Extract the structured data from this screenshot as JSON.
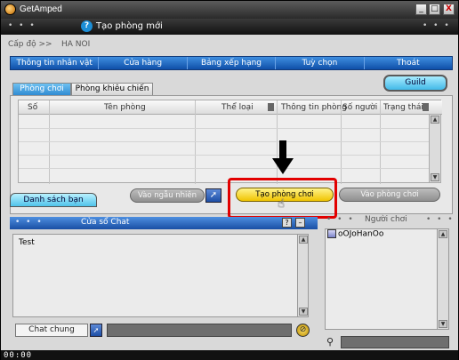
{
  "window": {
    "title": "GetAmped",
    "minimize": "_",
    "maximize": "□",
    "close": "X"
  },
  "subheader": {
    "title": "Tạo phòng mới",
    "help": "?"
  },
  "breadcrumb": {
    "level": "Cấp độ >>",
    "location": "HA NOI"
  },
  "nav": {
    "items": [
      "Thông tin nhân vật",
      "Cửa hàng",
      "Bảng xếp hạng",
      "Tuỳ chọn",
      "Thoát"
    ]
  },
  "tabs": {
    "rooms": "Phòng chơi",
    "challenge": "Phòng khiêu chiến",
    "guild": "Guild"
  },
  "room_table": {
    "headers": {
      "no": "Số",
      "name": "Tên phòng",
      "mode": "Thể loại",
      "info": "Thông tin phòng",
      "players": "Số người",
      "status": "Trạng thái"
    },
    "rows": []
  },
  "actions": {
    "random": "Vào ngẫu nhiên",
    "create": "Tạo phòng chơi",
    "join": "Vào phòng chơi"
  },
  "friends_tab": "Danh sách bạn",
  "chat": {
    "title": "Cửa sổ Chat",
    "messages": [
      "Test"
    ],
    "mode": "Chat chung",
    "input_value": ""
  },
  "players": {
    "label": "Người chơi",
    "list": [
      "oOJoHanOo"
    ]
  },
  "status": {
    "clock": "00:00"
  },
  "colors": {
    "nav_blue": "#1f5fbf",
    "highlight_red": "#e20000",
    "create_yellow": "#f0c400",
    "guild_cyan": "#42b9e8"
  }
}
